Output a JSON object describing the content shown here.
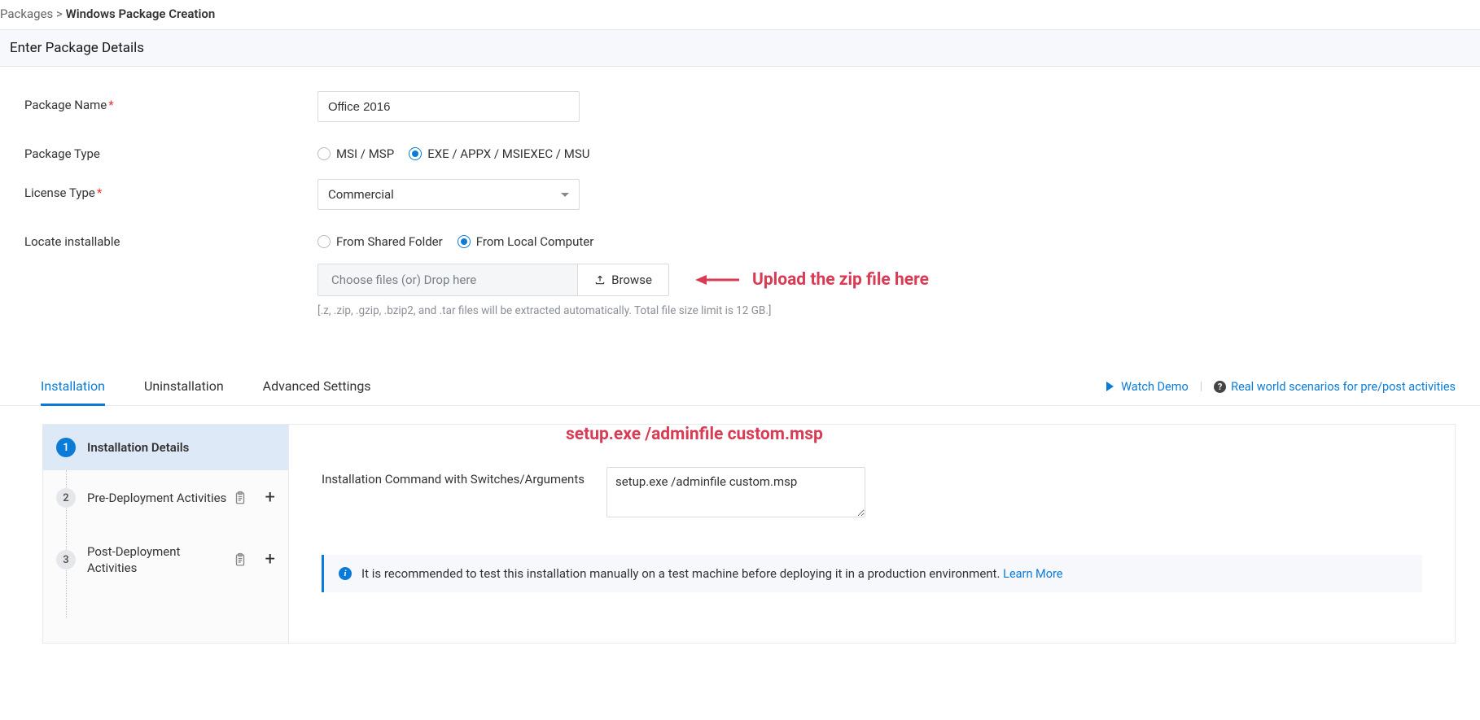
{
  "breadcrumb": {
    "root": "Packages",
    "sep": ">",
    "current": "Windows Package Creation"
  },
  "section_title": "Enter Package Details",
  "form": {
    "package_name_label": "Package Name",
    "package_name_value": "Office 2016",
    "package_type_label": "Package Type",
    "package_type_options": {
      "msi": "MSI / MSP",
      "exe": "EXE / APPX / MSIEXEC / MSU"
    },
    "license_type_label": "License Type",
    "license_type_value": "Commercial",
    "locate_label": "Locate installable",
    "locate_options": {
      "shared": "From Shared Folder",
      "local": "From Local Computer"
    },
    "file_drop_placeholder": "Choose files (or) Drop here",
    "browse_label": "Browse",
    "file_hint": "[.z, .zip, .gzip, .bzip2, and .tar files will be extracted automatically. Total file size limit is 12 GB.]"
  },
  "annotations": {
    "upload": "Upload the zip file here",
    "cmd": "setup.exe /adminfile custom.msp"
  },
  "tabs": {
    "installation": "Installation",
    "uninstallation": "Uninstallation",
    "advanced": "Advanced Settings",
    "watch_demo": "Watch Demo",
    "real_world": "Real world scenarios for pre/post activities"
  },
  "steps": {
    "s1": {
      "num": "1",
      "label": "Installation Details"
    },
    "s2": {
      "num": "2",
      "label": "Pre-Deployment Activities"
    },
    "s3": {
      "num": "3",
      "label": "Post-Deployment Activities"
    }
  },
  "detail": {
    "cmd_label": "Installation Command with Switches/Arguments",
    "cmd_value": "setup.exe /adminfile custom.msp",
    "info_text": "It is recommended to test this installation manually on a test machine before deploying it in a production environment. ",
    "learn_more": "Learn More"
  },
  "colors": {
    "accent": "#0b7bd8",
    "annotate": "#d93b54"
  }
}
